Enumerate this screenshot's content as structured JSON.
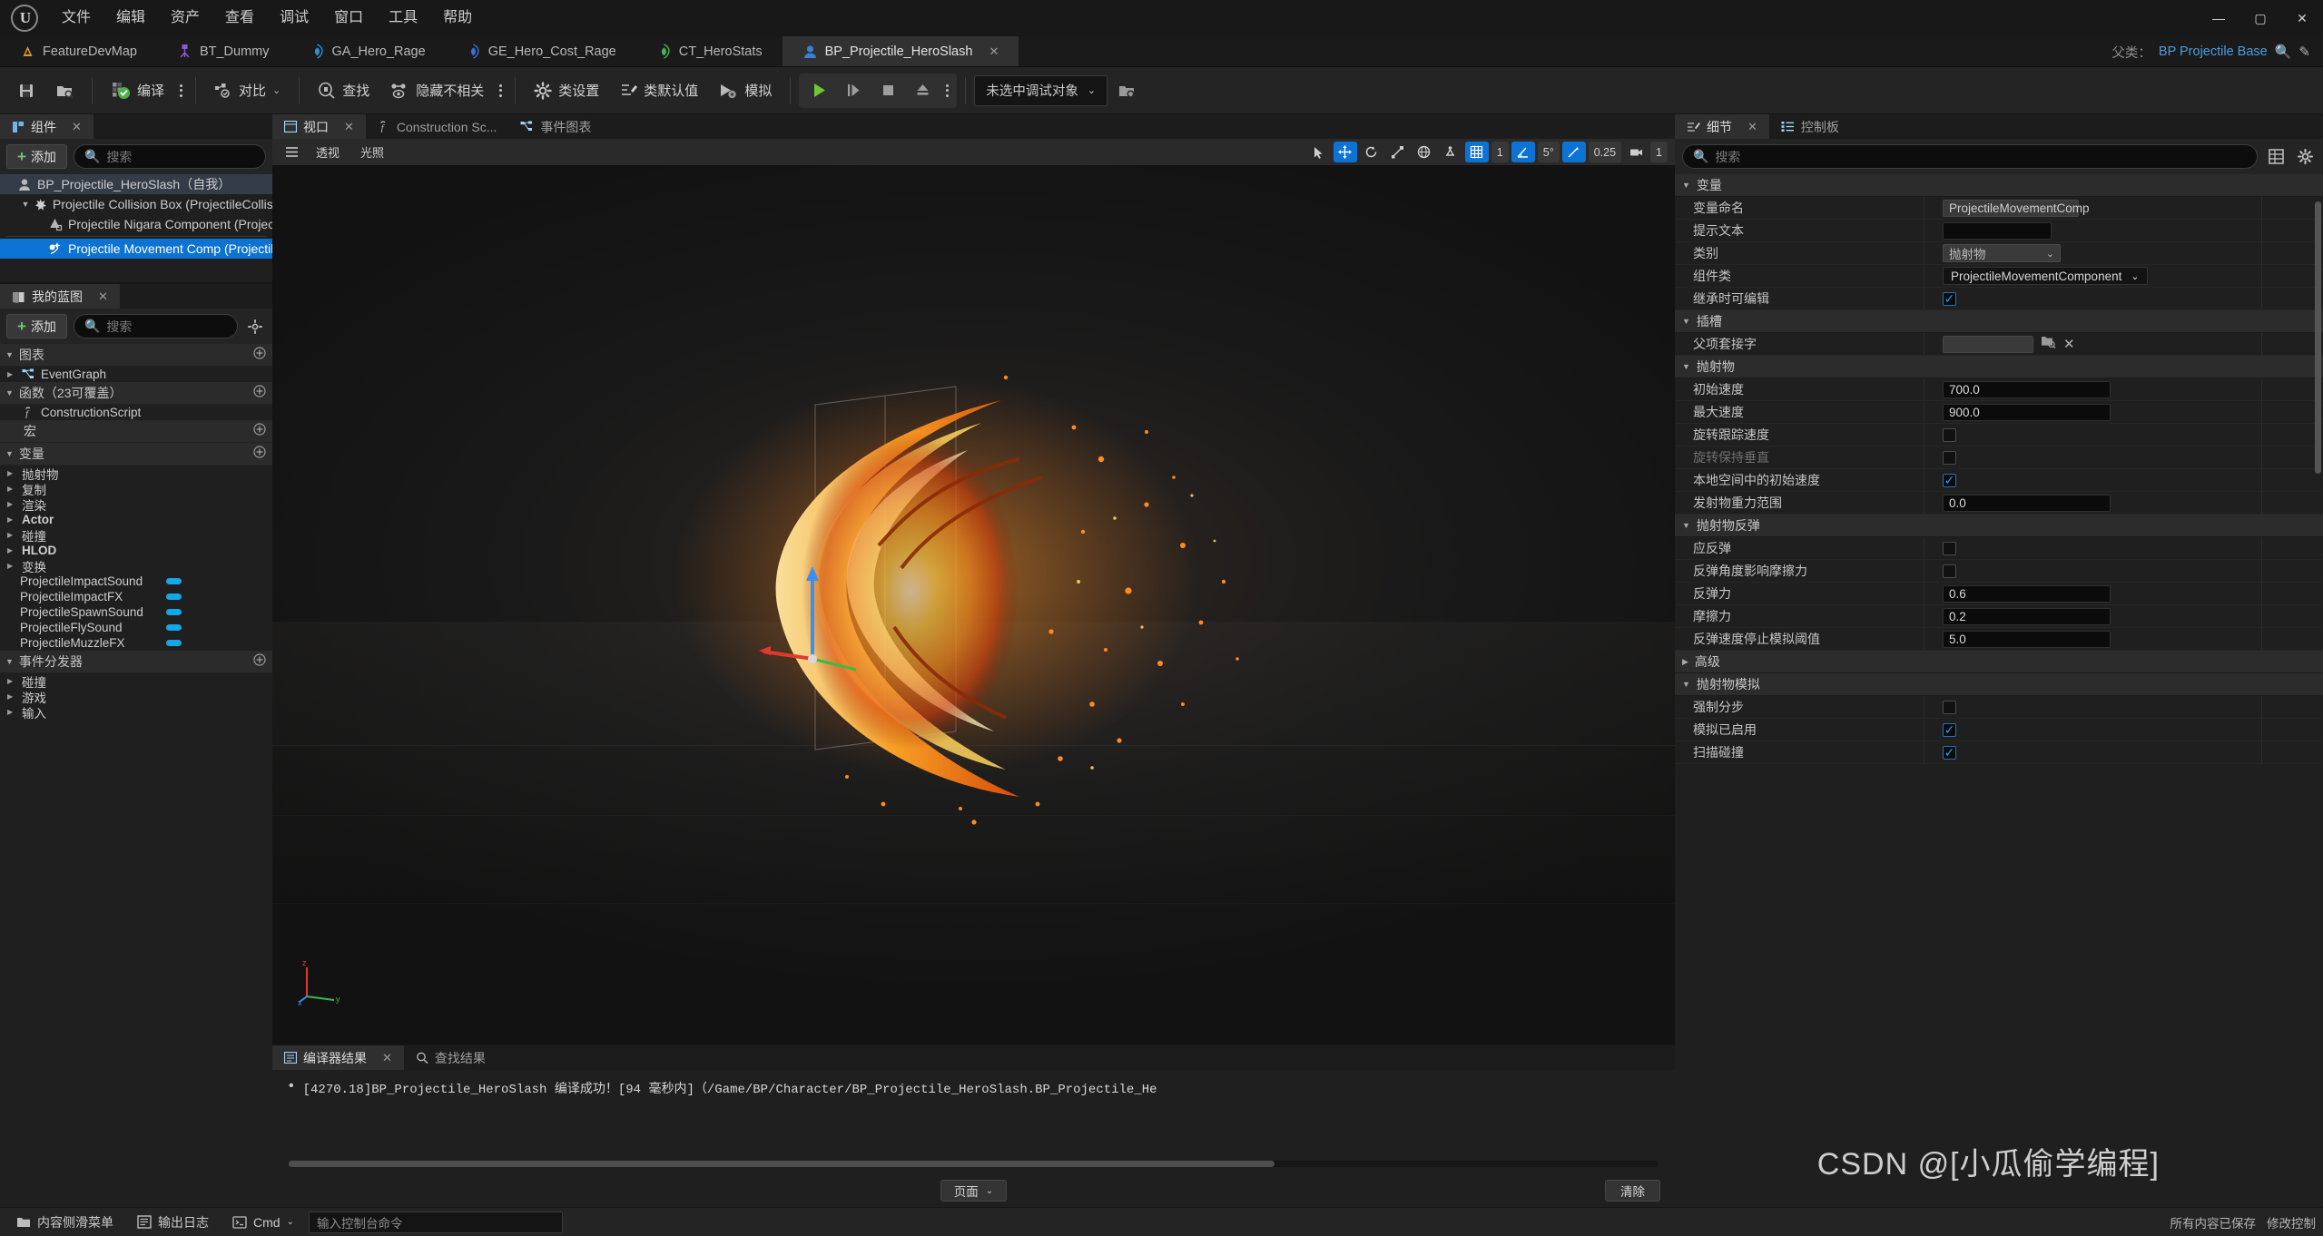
{
  "window": {
    "minimize": "—",
    "maximize": "▢",
    "close": "✕"
  },
  "menu": {
    "items": [
      "文件",
      "编辑",
      "资产",
      "查看",
      "调试",
      "窗口",
      "工具",
      "帮助"
    ]
  },
  "asset_tabs": {
    "items": [
      {
        "label": "FeatureDevMap",
        "icon": "level-icon",
        "icon_color": "#d99a2b",
        "active": false
      },
      {
        "label": "BT_Dummy",
        "icon": "behavior-tree-icon",
        "icon_color": "#8c5ad6",
        "active": false
      },
      {
        "label": "GA_Hero_Rage",
        "icon": "gameplay-ability-icon",
        "icon_color": "#2f8fcf",
        "active": false
      },
      {
        "label": "GE_Hero_Cost_Rage",
        "icon": "gameplay-effect-icon",
        "icon_color": "#3a6fd8",
        "active": false
      },
      {
        "label": "CT_HeroStats",
        "icon": "curve-table-icon",
        "icon_color": "#4caf50",
        "active": false
      },
      {
        "label": "BP_Projectile_HeroSlash",
        "icon": "blueprint-icon",
        "icon_color": "#3a7fd5",
        "active": true,
        "close": "✕"
      }
    ],
    "parent_class_label": "父类：",
    "parent_class_value": "BP Projectile Base"
  },
  "toolbar": {
    "save": "保存",
    "browse": "浏览",
    "compile": "编译",
    "diff": "对比",
    "find": "查找",
    "hide_unrelated": "隐藏不相关",
    "class_settings": "类设置",
    "class_defaults": "类默认值",
    "simulate": "模拟",
    "play": "播放",
    "step": "逐帧",
    "stop": "停止",
    "eject": "弹出",
    "debug_object": "未选中调试对象"
  },
  "components_panel": {
    "tab_title": "组件",
    "tab_close": "✕",
    "add_label": "添加",
    "search_placeholder": "搜索",
    "search_value": "",
    "tree": [
      {
        "label": "BP_Projectile_HeroSlash（自我）",
        "indent": 0,
        "state": "soft-selected",
        "arrow": "",
        "icon": "actor-icon"
      },
      {
        "label": "Projectile Collision Box (ProjectileCollisionBo",
        "indent": 1,
        "state": "normal",
        "arrow": "▼",
        "icon": "collision-icon"
      },
      {
        "label": "Projectile Nigara Component (ProjectileNiga",
        "indent": 2,
        "state": "normal",
        "arrow": "",
        "icon": "niagara-icon"
      },
      {
        "label": "Projectile Movement Comp (ProjectileMovem",
        "indent": 2,
        "state": "selected",
        "arrow": "",
        "icon": "movement-icon"
      }
    ]
  },
  "blueprint_panel": {
    "tab_title": "我的蓝图",
    "tab_close": "✕",
    "add_label": "添加",
    "search_placeholder": "搜索",
    "search_value": "",
    "settings_icon": "gear-icon",
    "sections": [
      {
        "title": "图表",
        "collapsed": false,
        "has_add": true,
        "items": [
          {
            "label": "EventGraph",
            "tri": "▶",
            "icon": "event-graph-icon",
            "bold": false
          }
        ]
      },
      {
        "title": "函数（23可覆盖）",
        "collapsed": false,
        "has_add": true,
        "items": [
          {
            "label": "ConstructionScript",
            "tri": "",
            "icon": "function-icon",
            "bold": false
          }
        ]
      },
      {
        "title": "宏",
        "collapsed": false,
        "has_add": true,
        "items": []
      },
      {
        "title": "变量",
        "collapsed": false,
        "has_add": true,
        "items": [
          {
            "label": "抛射物",
            "tri": "▶",
            "icon": "",
            "bold": false
          },
          {
            "label": "复制",
            "tri": "▶",
            "icon": "",
            "bold": false
          },
          {
            "label": "渲染",
            "tri": "▶",
            "icon": "",
            "bold": false
          },
          {
            "label": "Actor",
            "tri": "▶",
            "icon": "",
            "bold": true
          },
          {
            "label": "碰撞",
            "tri": "▶",
            "icon": "",
            "bold": false
          },
          {
            "label": "HLOD",
            "tri": "▶",
            "icon": "",
            "bold": true
          },
          {
            "label": "变换",
            "tri": "▶",
            "icon": "",
            "bold": false
          }
        ],
        "variables": [
          {
            "name": "ProjectileImpactSound",
            "pill_color": "#12a8e8"
          },
          {
            "name": "ProjectileImpactFX",
            "pill_color": "#12a8e8"
          },
          {
            "name": "ProjectileSpawnSound",
            "pill_color": "#12a8e8"
          },
          {
            "name": "ProjectileFlySound",
            "pill_color": "#12a8e8"
          },
          {
            "name": "ProjectileMuzzleFX",
            "pill_color": "#12a8e8"
          }
        ]
      },
      {
        "title": "事件分发器",
        "collapsed": false,
        "has_add": true,
        "items": [
          {
            "label": "碰撞",
            "tri": "▶",
            "icon": "",
            "bold": false
          },
          {
            "label": "游戏",
            "tri": "▶",
            "icon": "",
            "bold": false
          },
          {
            "label": "输入",
            "tri": "▶",
            "icon": "",
            "bold": false
          }
        ]
      }
    ]
  },
  "center_tabs": {
    "items": [
      {
        "label": "视口",
        "icon": "viewport-icon",
        "active": true,
        "close": "✕"
      },
      {
        "label": "Construction Sc...",
        "icon": "construction-icon",
        "active": false
      },
      {
        "label": "事件图表",
        "icon": "event-graph-icon",
        "active": false
      }
    ]
  },
  "viewport_toolbar": {
    "menu_icon": "hamburger-icon",
    "perspective": "透视",
    "lit": "光照",
    "select_icon": "cursor-icon",
    "translate_icon": "move-icon",
    "rotate_icon": "rotate-icon",
    "scale_icon": "scale-icon",
    "coords_icon": "world-coords-icon",
    "snap_icon": "snap-icon",
    "grid_snap_value": "1",
    "angle_snap_value": "5°",
    "scale_snap_value": "0.25",
    "camera_speed_value": "1"
  },
  "results_panel": {
    "tabs": [
      {
        "label": "编译器结果",
        "icon": "compiler-icon",
        "active": true,
        "close": "✕"
      },
      {
        "label": "查找结果",
        "icon": "search-icon",
        "active": false
      }
    ],
    "message": "[4270.18]BP_Projectile_HeroSlash 编译成功！[94 毫秒内]（/Game/BP/Character/BP_Projectile_HeroSlash.BP_Projectile_He",
    "bullet": "•",
    "page_label": "页面",
    "clear_label": "清除"
  },
  "details_panel": {
    "tabs": [
      {
        "label": "细节",
        "icon": "details-icon",
        "active": true,
        "close": "✕"
      },
      {
        "label": "控制板",
        "icon": "palette-icon",
        "active": false
      }
    ],
    "search_placeholder": "搜索",
    "search_value": "",
    "grid_icon": "grid-view-icon",
    "settings_icon": "gear-icon",
    "sections": [
      {
        "title": "变量",
        "collapsed": false,
        "rows": [
          {
            "label": "变量命名",
            "type": "readonly-text",
            "value": "ProjectileMovementComp",
            "dim": false
          },
          {
            "label": "提示文本",
            "type": "text",
            "value": "",
            "dim": false
          },
          {
            "label": "类别",
            "type": "combo-disabled",
            "value": "抛射物",
            "dim": false
          },
          {
            "label": "组件类",
            "type": "combo-dark",
            "value": "ProjectileMovementComponent",
            "dim": false
          },
          {
            "label": "继承时可编辑",
            "type": "checkbox",
            "value": true,
            "dim": false
          }
        ]
      },
      {
        "title": "插槽",
        "collapsed": false,
        "rows": [
          {
            "label": "父项套接字",
            "type": "text-browse",
            "value": "",
            "dim": false
          }
        ]
      },
      {
        "title": "抛射物",
        "collapsed": false,
        "rows": [
          {
            "label": "初始速度",
            "type": "number",
            "value": "700.0",
            "dim": false
          },
          {
            "label": "最大速度",
            "type": "number",
            "value": "900.0",
            "dim": false
          },
          {
            "label": "旋转跟踪速度",
            "type": "checkbox",
            "value": false,
            "dim": false
          },
          {
            "label": "旋转保持垂直",
            "type": "checkbox",
            "value": false,
            "dim": true
          },
          {
            "label": "本地空间中的初始速度",
            "type": "checkbox",
            "value": true,
            "dim": false
          },
          {
            "label": "发射物重力范围",
            "type": "number",
            "value": "0.0",
            "dim": false
          }
        ]
      },
      {
        "title": "抛射物反弹",
        "collapsed": false,
        "rows": [
          {
            "label": "应反弹",
            "type": "checkbox",
            "value": false,
            "dim": false
          },
          {
            "label": "反弹角度影响摩擦力",
            "type": "checkbox",
            "value": false,
            "dim": false
          },
          {
            "label": "反弹力",
            "type": "number",
            "value": "0.6",
            "dim": false
          },
          {
            "label": "摩擦力",
            "type": "number",
            "value": "0.2",
            "dim": false
          },
          {
            "label": "反弹速度停止模拟阈值",
            "type": "number",
            "value": "5.0",
            "dim": false
          }
        ]
      },
      {
        "title": "高级",
        "collapsed": true,
        "rows": []
      },
      {
        "title": "抛射物模拟",
        "collapsed": false,
        "rows": [
          {
            "label": "强制分步",
            "type": "checkbox",
            "value": false,
            "dim": false
          },
          {
            "label": "模拟已启用",
            "type": "checkbox",
            "value": true,
            "dim": false
          },
          {
            "label": "扫描碰撞",
            "type": "checkbox",
            "value": true,
            "dim": false
          }
        ]
      }
    ]
  },
  "statusbar": {
    "content_drawer": "内容侧滑菜单",
    "output_log": "输出日志",
    "cmd_label": "Cmd",
    "cmd_placeholder": "输入控制台命令",
    "all_saved": "所有内容已保存",
    "revision": "修改控制"
  },
  "watermark": "CSDN @[小瓜偷学编程]"
}
